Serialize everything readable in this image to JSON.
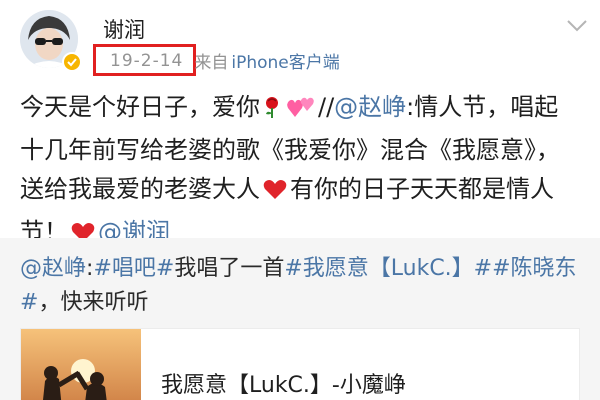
{
  "post": {
    "author": "谢润",
    "date": "19-2-14",
    "source_prefix": "来自",
    "source_client": "iPhone客户端",
    "text_segments": {
      "s1": "今天是个好日子，爱你",
      "s2": "//",
      "mention1": "@赵峥",
      "s3": ":情人节，唱起十几年前写给老婆的歌《我爱你》混合《我愿意》，送给我最爱的老婆大人",
      "s4": "有你的日子天天都是情人节！",
      "mention2": "@谢润"
    },
    "icons": {
      "avatar": "avatar-photo",
      "verified": "verified-badge-icon",
      "menu": "chevron-down-icon",
      "rose": "rose-emoji-icon",
      "hearts": "pink-hearts-emoji-icon",
      "red_heart_1": "red-heart-emoji-icon",
      "red_heart_2": "red-heart-emoji-icon"
    }
  },
  "repost": {
    "mention": "@赵峥",
    "colon": ":",
    "topic1": "#唱吧#",
    "text1": "我唱了一首",
    "topic2": "#我愿意【LukC.】#",
    "topic3": "#陈晓东#",
    "text2": "，快来听听",
    "card": {
      "title": "我愿意【LukC.】-小魔峥"
    }
  },
  "colors": {
    "link": "#4b76a6",
    "date_highlight": "#e12020",
    "verified": "#f7b500",
    "repost_bg": "#f5f5f5"
  }
}
